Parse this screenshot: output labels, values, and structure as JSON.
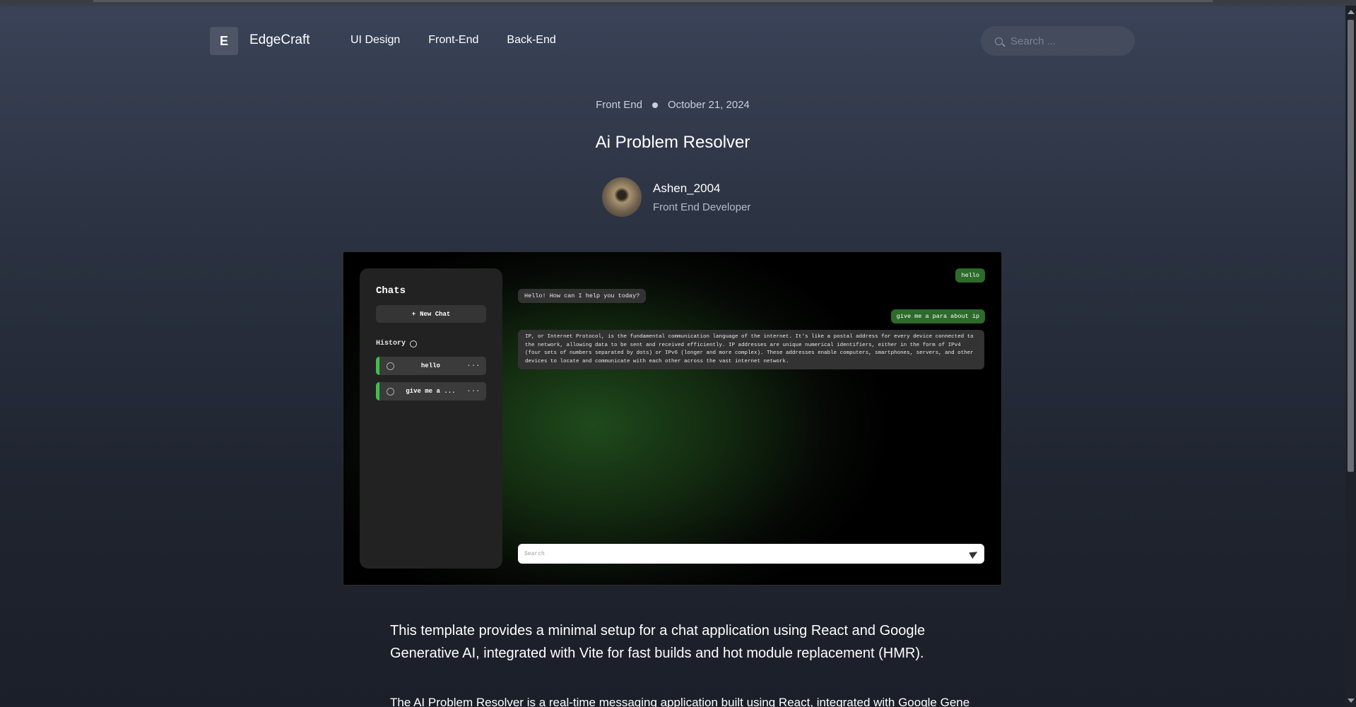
{
  "header": {
    "logo_letter": "E",
    "brand": "EdgeCraft",
    "nav": [
      "UI Design",
      "Front-End",
      "Back-End"
    ],
    "search_placeholder": "Search ..."
  },
  "post": {
    "category": "Front End",
    "date": "October 21, 2024",
    "title": "Ai Problem Resolver",
    "author": {
      "name": "Ashen_2004",
      "role": "Front End Developer"
    }
  },
  "hero": {
    "panel_title": "Chats",
    "new_chat": "New Chat",
    "history_label": "History",
    "history_items": [
      "hello",
      "give me a ..."
    ],
    "messages": {
      "user1": "hello",
      "bot1": "Hello! How can I help you today?",
      "user2": "give me a para about ip",
      "bot2": "IP, or Internet Protocol, is the fundamental communication language of the internet. It's like a postal address for every device connected to the network, allowing data to be sent and received efficiently. IP addresses are unique numerical identifiers, either in the form of IPv4 (four sets of numbers separated by dots) or IPv6 (longer and more complex). These addresses enable computers, smartphones, servers, and other devices to locate and communicate with each other across the vast internet network."
    },
    "input_placeholder": "Search"
  },
  "content": {
    "para1": "This template provides a minimal setup for a chat application using React and Google Generative AI, integrated with Vite for fast builds and hot module replacement (HMR).",
    "para2": "The AI Problem Resolver is a real-time messaging application built using React, integrated with Google Generative"
  }
}
